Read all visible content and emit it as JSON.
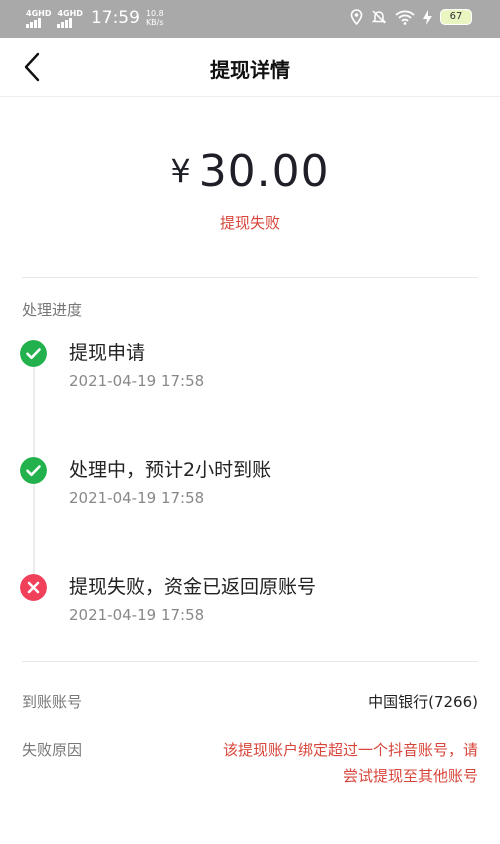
{
  "status_bar": {
    "network1": "4GHD",
    "network2": "4GHD",
    "time": "17:59",
    "speed_value": "10.8",
    "speed_unit": "KB/s",
    "battery": "67"
  },
  "nav": {
    "title": "提现详情"
  },
  "amount": {
    "currency": "¥",
    "value": "30.00",
    "status": "提现失败"
  },
  "progress": {
    "label": "处理进度",
    "steps": [
      {
        "title": "提现申请",
        "time": "2021-04-19 17:58",
        "state": "success"
      },
      {
        "title": "处理中，预计2小时到账",
        "time": "2021-04-19 17:58",
        "state": "success"
      },
      {
        "title": "提现失败，资金已返回原账号",
        "time": "2021-04-19 17:58",
        "state": "failed"
      }
    ]
  },
  "details": {
    "account_label": "到账账号",
    "account_value": "中国银行(7266)",
    "reason_label": "失败原因",
    "reason_line1": "该提现账户绑定超过一个抖音账号，请",
    "reason_line2": "尝试提现至其他账号"
  },
  "colors": {
    "success": "#22b14c",
    "failed": "#f0405a",
    "error_text": "#d8453a"
  }
}
